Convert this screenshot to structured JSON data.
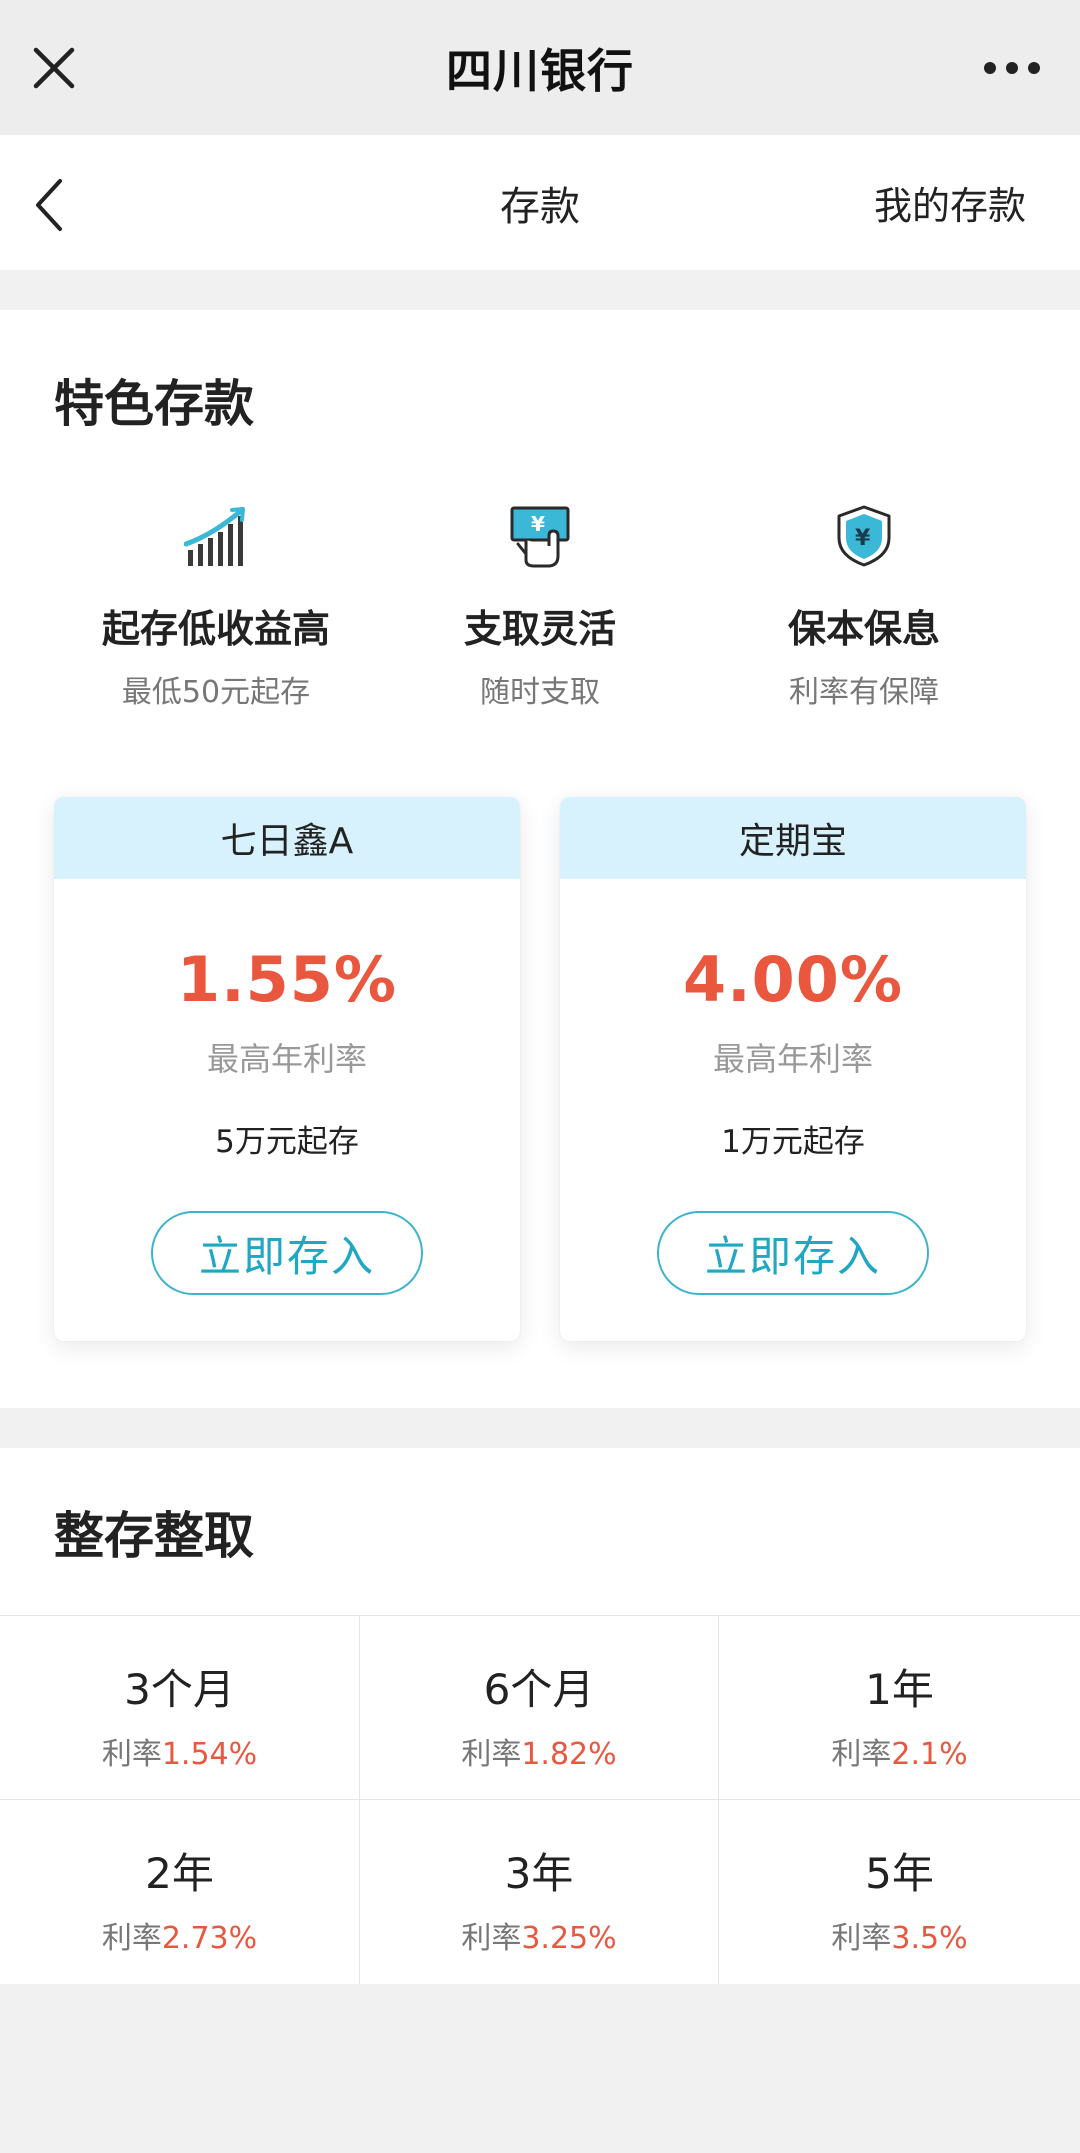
{
  "topbar": {
    "title": "四川银行",
    "close_icon": "close-icon",
    "more_icon": "more-dots-icon"
  },
  "nav": {
    "back_icon": "chevron-left-icon",
    "title": "存款",
    "right_link": "我的存款"
  },
  "special": {
    "title": "特色存款",
    "features": [
      {
        "icon": "rising-chart-icon",
        "title": "起存低收益高",
        "subtitle": "最低50元起存"
      },
      {
        "icon": "yuan-hand-icon",
        "title": "支取灵活",
        "subtitle": "随时支取"
      },
      {
        "icon": "yuan-shield-icon",
        "title": "保本保息",
        "subtitle": "利率有保障"
      }
    ],
    "products": [
      {
        "name": "七日鑫A",
        "rate": "1.55%",
        "rate_label": "最高年利率",
        "minimum": "5万元起存",
        "button": "立即存入"
      },
      {
        "name": "定期宝",
        "rate": "4.00%",
        "rate_label": "最高年利率",
        "minimum": "1万元起存",
        "button": "立即存入"
      }
    ]
  },
  "fixed": {
    "title": "整存整取",
    "rate_prefix": "利率",
    "terms": [
      {
        "term": "3个月",
        "rate": "1.54%"
      },
      {
        "term": "6个月",
        "rate": "1.82%"
      },
      {
        "term": "1年",
        "rate": "2.1%"
      },
      {
        "term": "2年",
        "rate": "2.73%"
      },
      {
        "term": "3年",
        "rate": "3.25%"
      },
      {
        "term": "5年",
        "rate": "3.5%"
      }
    ]
  },
  "colors": {
    "accent_red": "#e8573e",
    "accent_blue": "#1fa7c4",
    "card_header": "#d7f2fd"
  }
}
